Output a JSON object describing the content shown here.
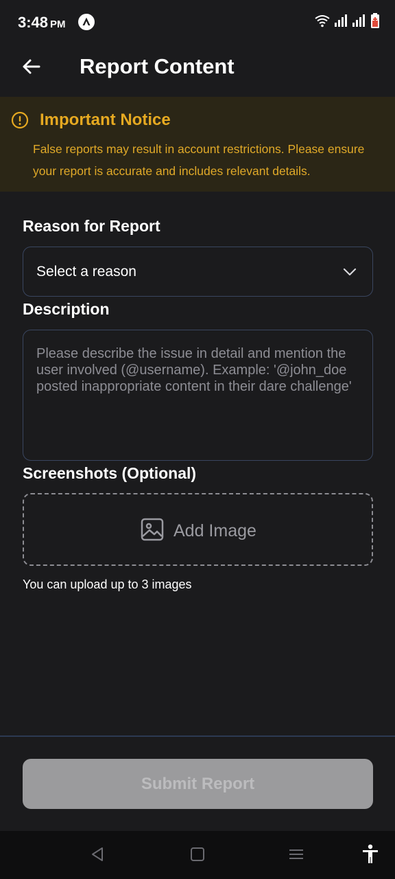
{
  "status_bar": {
    "time": "3:48",
    "ampm": "PM",
    "app_icon": "a-logo-icon",
    "icons": [
      "wifi-icon",
      "signal-icon",
      "signal-icon",
      "battery-icon"
    ]
  },
  "app_bar": {
    "back_icon": "arrow-left-icon",
    "title": "Report Content"
  },
  "notice": {
    "icon": "exclamation-circle-icon",
    "title": "Important Notice",
    "text": "False reports may result in account restrictions. Please ensure your report is accurate and includes relevant details."
  },
  "form": {
    "reason_label": "Reason for Report",
    "reason_value": "Select a reason",
    "reason_icon": "chevron-down-icon",
    "description_label": "Description",
    "description_placeholder": "Please describe the issue in detail and mention the user involved (@username). Example: '@john_doe posted inappropriate content in their dare challenge'",
    "screenshots_label": "Screenshots (Optional)",
    "add_image_label": "Add Image",
    "add_image_icon": "image-icon",
    "upload_hint": "You can upload up to 3 images"
  },
  "footer": {
    "submit_label": "Submit Report"
  },
  "nav_bar": {
    "icons": [
      "back-triangle-icon",
      "home-square-icon",
      "menu-icon",
      "accessibility-icon"
    ]
  },
  "colors": {
    "background": "#1b1b1d",
    "notice_bg": "#2b2616",
    "notice_accent": "#e6a921",
    "border": "#3a4660",
    "submit_disabled": "#9b9b9d"
  }
}
